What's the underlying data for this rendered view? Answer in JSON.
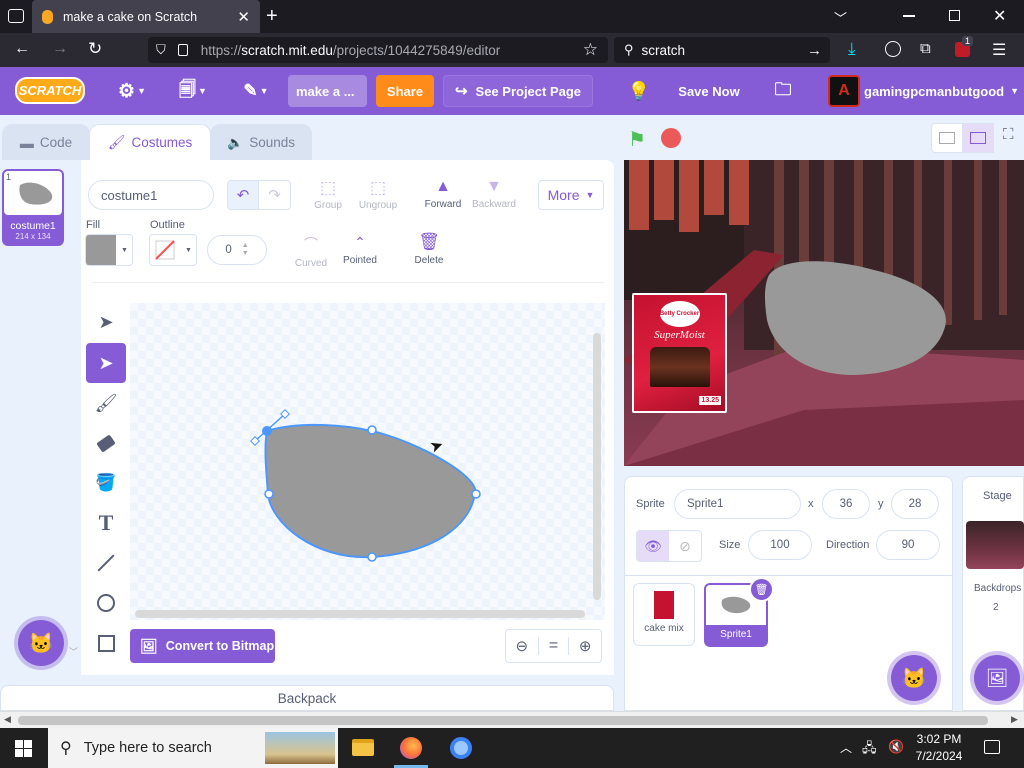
{
  "browser": {
    "tab_title": "make a cake on Scratch",
    "url_prefix": "https://",
    "url_domain": "scratch.mit.edu",
    "url_path": "/projects/1044275849/editor",
    "search_text": "scratch",
    "notif_badge": "1"
  },
  "menubar": {
    "logo": "SCRATCH",
    "project_title": "make a ...",
    "share_label": "Share",
    "see_project_label": "See Project Page",
    "save_now_label": "Save Now",
    "username": "gamingpcmanbutgood"
  },
  "tabs": {
    "code": "Code",
    "costumes": "Costumes",
    "sounds": "Sounds"
  },
  "costume_list": [
    {
      "index": "1",
      "name": "costume1",
      "size": "214 x 134"
    }
  ],
  "paint": {
    "costume_name": "costume1",
    "group": "Group",
    "ungroup": "Ungroup",
    "forward": "Forward",
    "backward": "Backward",
    "more": "More",
    "fill_label": "Fill",
    "outline_label": "Outline",
    "outline_width": "0",
    "curved": "Curved",
    "pointed": "Pointed",
    "delete": "Delete",
    "convert_label": "Convert to Bitmap",
    "zoom_reset": "="
  },
  "backpack_label": "Backpack",
  "sprite_info": {
    "sprite_label": "Sprite",
    "sprite_name": "Sprite1",
    "x_label": "x",
    "x_value": "36",
    "y_label": "y",
    "y_value": "28",
    "size_label": "Size",
    "size_value": "100",
    "direction_label": "Direction",
    "direction_value": "90"
  },
  "sprites": [
    {
      "name": "cake mix"
    },
    {
      "name": "Sprite1"
    }
  ],
  "stage_panel": {
    "stage_label": "Stage",
    "backdrops_label": "Backdrops",
    "backdrops_count": "2"
  },
  "product_box": {
    "brand": "Betty Crocker",
    "product": "SuperMoist",
    "price": "13.25"
  },
  "taskbar": {
    "search_placeholder": "Type here to search",
    "time": "3:02 PM",
    "date": "7/2/2024"
  },
  "colors": {
    "scratch_purple": "#855cd6",
    "share_orange": "#ff8c1a",
    "shape_fill": "#999999",
    "selection_blue": "#4c97ff"
  }
}
